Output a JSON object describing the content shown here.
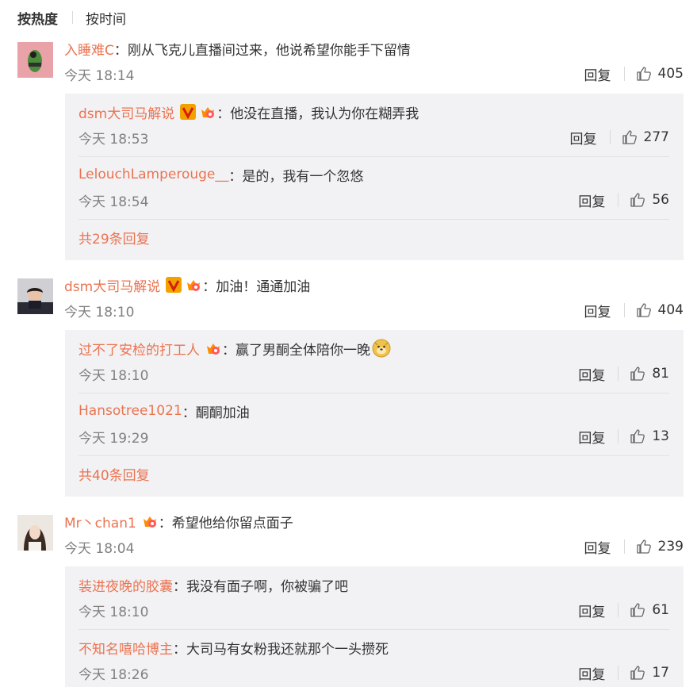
{
  "sort": {
    "active": "按热度",
    "other": "按时间"
  },
  "labels": {
    "reply": "回复"
  },
  "colors": {
    "username": "#eb7350",
    "reply_bg": "#f2f2f5",
    "time": "#808080"
  },
  "comments": [
    {
      "user": "入睡难C",
      "text": "刚从飞克儿直播间过来，他说希望你能手下留情",
      "time": "今天 18:14",
      "likes": "405",
      "replies": [
        {
          "user": "dsm大司马解说",
          "text": "他没在直播，我认为你在糊弄我",
          "time": "今天 18:53",
          "likes": "277",
          "badges": [
            "verified-v-icon",
            "fan-crown-icon"
          ]
        },
        {
          "user": "LelouchLamperouge__",
          "text": "是的，我有一个忽悠",
          "time": "今天 18:54",
          "likes": "56"
        }
      ],
      "more": "共29条回复"
    },
    {
      "user": "dsm大司马解说",
      "badges": [
        "verified-v-icon",
        "fan-crown-icon"
      ],
      "text": "加油！通通加油",
      "time": "今天 18:10",
      "likes": "404",
      "replies": [
        {
          "user": "过不了安检的打工人",
          "badges": [
            "fan-crown-icon"
          ],
          "text": "赢了男酮全体陪你一晚",
          "emoji": "doge-emoji-icon",
          "time": "今天 18:10",
          "likes": "81"
        },
        {
          "user": "Hansotree1021",
          "text": "酮酮加油",
          "time": "今天 19:29",
          "likes": "13"
        }
      ],
      "more": "共40条回复"
    },
    {
      "user": "Mr丶chan1",
      "badges": [
        "fan-crown-icon"
      ],
      "text": "希望他给你留点面子",
      "time": "今天 18:04",
      "likes": "239",
      "replies": [
        {
          "user": "装进夜晚的胶囊",
          "text": "我没有面子啊，你被骗了吧",
          "time": "今天 18:10",
          "likes": "61"
        },
        {
          "user": "不知名嘻哈博主",
          "text": "大司马有女粉我还就那个一头攒死",
          "time": "今天 18:26",
          "likes": "17"
        }
      ]
    }
  ]
}
